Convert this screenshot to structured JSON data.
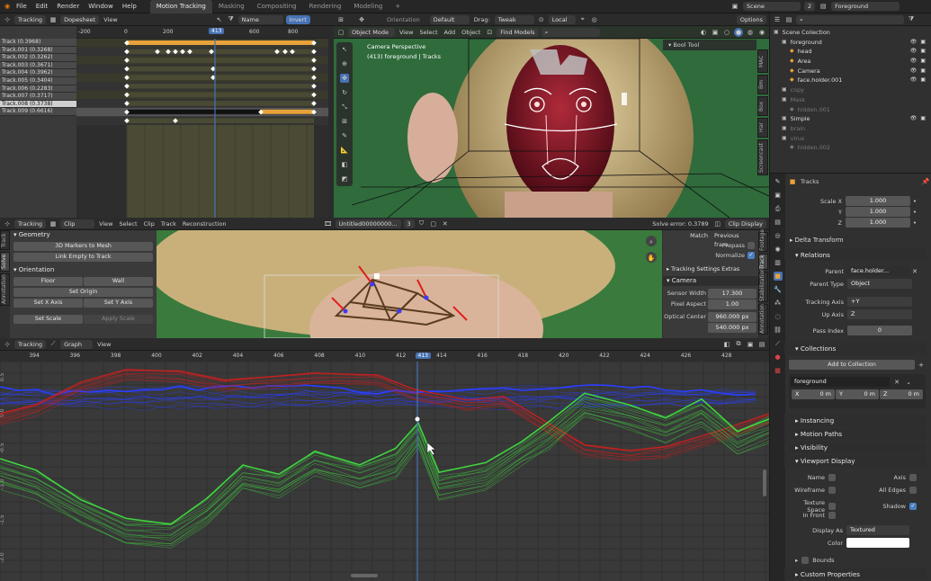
{
  "topbar": {
    "menus": [
      "File",
      "Edit",
      "Render",
      "Window",
      "Help"
    ],
    "workspaces": [
      "Motion Tracking",
      "Masking",
      "Compositing",
      "Rendering",
      "Modeling"
    ],
    "scene_label": "Scene",
    "scene_num": "2",
    "viewlayer": "Foreground"
  },
  "dopesheet": {
    "mode": "Tracking",
    "view_mode": "Dopesheet",
    "view": "View",
    "name_sort": "Name",
    "invert": "Invert",
    "ruler": [
      "-200",
      "0",
      "200",
      "413",
      "600",
      "800"
    ],
    "current_frame": "413",
    "tracks": [
      "Track (0.3968)",
      "Track.001 (0.3268)",
      "Track.002 (0.3262)",
      "Track.003 (0.3671)",
      "Track.004 (0.3962)",
      "Track.005 (0.3404)",
      "Track.006 (0.2283)",
      "Track.007 (0.3717)",
      "Track.008 (0.3738)",
      "Track.009 (0.6616)"
    ],
    "selected_track": 8
  },
  "viewport": {
    "orientation_label": "Orientation",
    "orientation": "Default",
    "drag_label": "Drag:",
    "drag": "Tweak",
    "pivot": "Local",
    "options": "Options",
    "mode": "Object Mode",
    "menus": [
      "View",
      "Select",
      "Add",
      "Object"
    ],
    "find": "Find Models",
    "info1": "Camera Perspective",
    "info2": "(413) foreground | Tracks",
    "bool_tool": "Bool Tool",
    "side_tabs": [
      "MAC",
      "Bm",
      "Box",
      "Har",
      "Screencast"
    ]
  },
  "clip": {
    "mode": "Tracking",
    "type": "Clip",
    "menus": [
      "View",
      "Select",
      "Clip",
      "Track",
      "Reconstruction"
    ],
    "filename": "Untitled00000000...",
    "users": "3",
    "solve_error": "Solve error: 0.3789",
    "clip_display": "Clip Display",
    "match_label": "Match",
    "match": "Previous fram",
    "prepass": "Prepass",
    "normalize": "Normalize",
    "tracking_extras": "Tracking Settings Extras",
    "camera_section": "Camera",
    "sensor_width_label": "Sensor Width",
    "sensor_width": "17.300",
    "pixel_aspect_label": "Pixel Aspect",
    "pixel_aspect": "1.00",
    "optical_center_label": "Optical Center",
    "optical_x": "960.000 px",
    "optical_y": "540.000 px",
    "right_tabs": [
      "Footage",
      "Track",
      "Stabilization",
      "Annotation"
    ],
    "left_tabs": [
      "Track",
      "Solve",
      "Annotation"
    ],
    "geometry": "Geometry",
    "markers_to_mesh": "3D Markers to Mesh",
    "link_empty": "Link Empty to Track",
    "orientation": "Orientation",
    "floor": "Floor",
    "wall": "Wall",
    "set_origin": "Set Origin",
    "set_x": "Set X Axis",
    "set_y": "Set Y Axis",
    "set_scale": "Set Scale",
    "apply_scale": "Apply Scale"
  },
  "graph": {
    "mode": "Tracking",
    "type": "Graph",
    "view": "View",
    "frames": [
      "394",
      "396",
      "398",
      "400",
      "402",
      "404",
      "406",
      "408",
      "410",
      "412",
      "413",
      "414",
      "416",
      "418",
      "420",
      "422",
      "424",
      "426",
      "428"
    ],
    "yvals": [
      "0.5",
      "0.0",
      "-0.5",
      "-1.0",
      "-1.5",
      "-2.0"
    ],
    "red_color": "#c82020",
    "green_color": "#3fd43f",
    "blue_color": "#2a3fff"
  },
  "outliner": {
    "items": [
      {
        "name": "Scene Collection",
        "level": 0,
        "dim": false
      },
      {
        "name": "foreground",
        "level": 1,
        "dim": false
      },
      {
        "name": "head",
        "level": 2,
        "dim": false
      },
      {
        "name": "Area",
        "level": 2,
        "dim": false
      },
      {
        "name": "Camera",
        "level": 2,
        "dim": false
      },
      {
        "name": "face.holder.001",
        "level": 2,
        "dim": false
      },
      {
        "name": "copy",
        "level": 1,
        "dim": true
      },
      {
        "name": "Mask",
        "level": 1,
        "dim": true
      },
      {
        "name": "hidden.001",
        "level": 2,
        "dim": true
      },
      {
        "name": "Simple",
        "level": 1,
        "dim": false
      },
      {
        "name": "brain",
        "level": 1,
        "dim": true
      },
      {
        "name": "virus",
        "level": 1,
        "dim": true
      },
      {
        "name": "hidden.002",
        "level": 2,
        "dim": true
      }
    ]
  },
  "props": {
    "object_name": "Tracks",
    "scale_x_label": "Scale X",
    "scale_y_label": "Y",
    "scale_z_label": "Z",
    "scale_x": "1.000",
    "scale_y": "1.000",
    "scale_z": "1.000",
    "delta_transform": "Delta Transform",
    "relations": "Relations",
    "parent_label": "Parent",
    "parent": "face.holder...",
    "parent_type_label": "Parent Type",
    "parent_type": "Object",
    "tracking_axis_label": "Tracking Axis",
    "tracking_axis": "+Y",
    "up_axis_label": "Up Axis",
    "up_axis": "Z",
    "pass_index_label": "Pass Index",
    "pass_index": "0",
    "collections": "Collections",
    "add_to_collection": "Add to Collection",
    "collection_name": "foreground",
    "cx_label": "X",
    "cx": "0 m",
    "cy_label": "Y",
    "cy": "0 m",
    "cz_label": "Z",
    "cz": "0 m",
    "instancing": "Instancing",
    "motion_paths": "Motion Paths",
    "visibility": "Visibility",
    "viewport_display": "Viewport Display",
    "name_label": "Name",
    "axis_label": "Axis",
    "wireframe_label": "Wireframe",
    "all_edges_label": "All Edges",
    "texture_space_label": "Texture Space",
    "shadow_label": "Shadow",
    "in_front_label": "In Front",
    "display_as_label": "Display As",
    "display_as": "Textured",
    "color_label": "Color",
    "bounds": "Bounds",
    "custom_props": "Custom Properties"
  }
}
